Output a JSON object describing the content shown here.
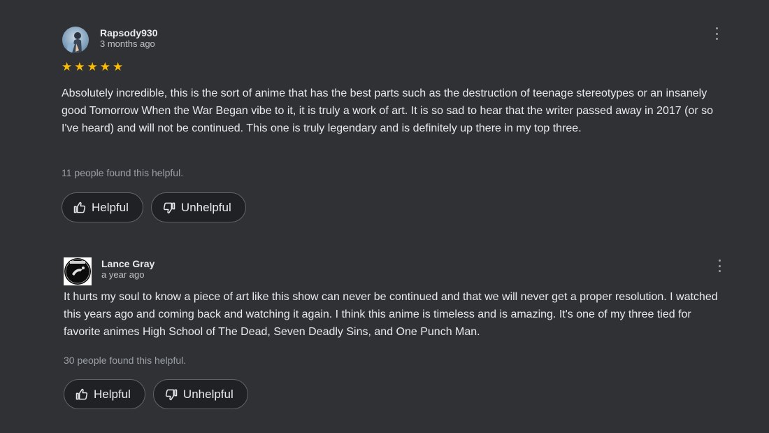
{
  "reviews": [
    {
      "author": "Rapsody930",
      "date": "3 months ago",
      "rating": 5,
      "text": "Absolutely incredible, this is the sort of anime that has the best parts such as the destruction of teenage stereotypes or an insanely good Tomorrow When the War Began vibe to it, it is truly a work of art. It is so sad to hear that the writer passed away in 2017 (or so I've heard) and will not be continued. This one is truly legendary and is definitely up there in my top three.",
      "helpful_count": "11 people found this helpful.",
      "helpful_label": "Helpful",
      "unhelpful_label": "Unhelpful",
      "avatar_icon": "avatar-photo"
    },
    {
      "author": "Lance Gray",
      "date": "a year ago",
      "text": "It hurts my soul to know a piece of art like this show can never be continued and that we will never get a proper resolution. I watched this years ago and coming back and watching it again. I think this anime is timeless and is amazing. It's one of my three tied for favorite animes High School of The Dead, Seven Deadly Sins, and One Punch Man.",
      "helpful_count": "30 people found this helpful.",
      "helpful_label": "Helpful",
      "unhelpful_label": "Unhelpful",
      "avatar_icon": "avatar-logo"
    }
  ],
  "icons": {
    "more": "more-vert-icon",
    "thumb_up": "thumb-up-icon",
    "thumb_down": "thumb-down-icon",
    "star": "star-icon"
  },
  "colors": {
    "background": "#303134",
    "star": "#fbbc04",
    "text": "#e8eaed",
    "muted": "#9aa0a6"
  }
}
